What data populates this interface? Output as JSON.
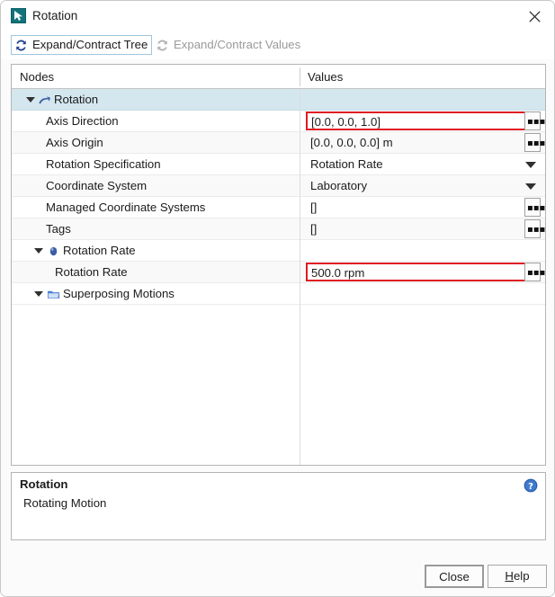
{
  "window": {
    "title": "Rotation",
    "icon": "rotation-app-icon",
    "close_icon": "close-icon"
  },
  "toolbar": {
    "buttons": [
      {
        "label": "Expand/Contract Tree",
        "icon": "refresh-cycle-icon",
        "enabled": true,
        "focused": true
      },
      {
        "label": "Expand/Contract Values",
        "icon": "refresh-cycle-icon",
        "enabled": false,
        "focused": false
      }
    ]
  },
  "table": {
    "columns": [
      "Nodes",
      "Values"
    ],
    "rows": [
      {
        "node": "Rotation",
        "value": "",
        "indent": 0,
        "twisty": "down",
        "icon": "rotation-arrow-icon",
        "selected": true,
        "editor": "none"
      },
      {
        "node": "Axis Direction",
        "value": "[0.0, 0.0, 1.0]",
        "indent": 1,
        "twisty": "none",
        "icon": "none",
        "selected": false,
        "editor": "ellipsis",
        "highlighted": true
      },
      {
        "node": "Axis Origin",
        "value": "[0.0, 0.0, 0.0] m",
        "indent": 1,
        "twisty": "none",
        "icon": "none",
        "selected": false,
        "editor": "ellipsis"
      },
      {
        "node": "Rotation Specification",
        "value": "Rotation Rate",
        "indent": 1,
        "twisty": "none",
        "icon": "none",
        "selected": false,
        "editor": "dropdown"
      },
      {
        "node": "Coordinate System",
        "value": "Laboratory",
        "indent": 1,
        "twisty": "none",
        "icon": "none",
        "selected": false,
        "editor": "dropdown"
      },
      {
        "node": "Managed Coordinate Systems",
        "value": "[]",
        "indent": 1,
        "twisty": "none",
        "icon": "none",
        "selected": false,
        "editor": "ellipsis"
      },
      {
        "node": "Tags",
        "value": "[]",
        "indent": 1,
        "twisty": "none",
        "icon": "none",
        "selected": false,
        "editor": "ellipsis"
      },
      {
        "node": "Rotation Rate",
        "value": "",
        "indent": 0,
        "twisty": "down",
        "icon": "blue-sphere-icon",
        "selected": false,
        "editor": "none"
      },
      {
        "node": "Rotation Rate",
        "value": "500.0 rpm",
        "indent": 1,
        "twisty": "none",
        "icon": "none",
        "selected": false,
        "editor": "ellipsis",
        "highlighted": true
      },
      {
        "node": "Superposing Motions",
        "value": "",
        "indent": 0,
        "twisty": "down",
        "icon": "folder-icon",
        "selected": false,
        "editor": "none"
      }
    ]
  },
  "description": {
    "title": "Rotation",
    "body": "Rotating Motion",
    "help_icon": "help-circle-icon"
  },
  "footer": {
    "close_label": "Close",
    "help_label_pre": "",
    "help_label_mnemonic": "H",
    "help_label_post": "elp"
  },
  "colors": {
    "selection": "#d4e7ee",
    "highlight_border": "#e01b24",
    "icon_blue": "#3b5ea8",
    "folder_blue": "#4a7fd4",
    "help_blue": "#2a5db0"
  }
}
